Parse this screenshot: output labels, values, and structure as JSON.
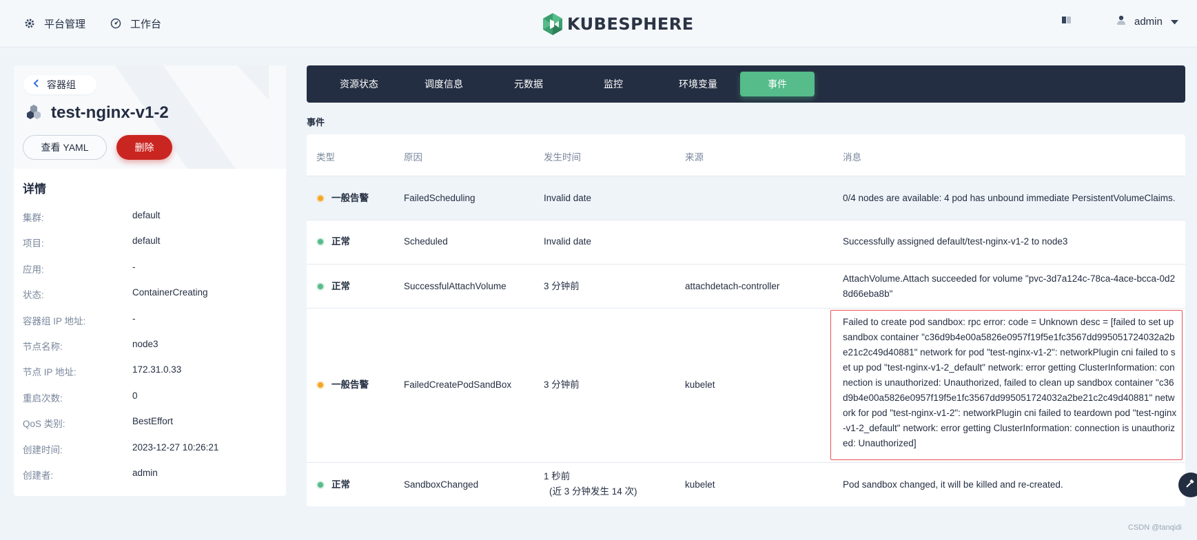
{
  "topbar": {
    "platform_label": "平台管理",
    "workbench_label": "工作台",
    "brand_text": "KUBESPHERE",
    "user_name": "admin",
    "icons": {
      "platform": "gear-icon",
      "workbench": "dashboard-icon",
      "docs": "book-icon",
      "user": "user-icon",
      "dropdown": "caret-down-icon"
    }
  },
  "sidebar": {
    "back_label": "容器组",
    "pod_name": "test-nginx-v1-2",
    "view_yaml_label": "查看 YAML",
    "delete_label": "删除",
    "details_title": "详情",
    "details": [
      {
        "key": "集群:",
        "value": "default"
      },
      {
        "key": "项目:",
        "value": "default"
      },
      {
        "key": "应用:",
        "value": "-"
      },
      {
        "key": "状态:",
        "value": "ContainerCreating"
      },
      {
        "key": "容器组 IP 地址:",
        "value": "-"
      },
      {
        "key": "节点名称:",
        "value": "node3"
      },
      {
        "key": "节点 IP 地址:",
        "value": "172.31.0.33"
      },
      {
        "key": "重启次数:",
        "value": "0"
      },
      {
        "key": "QoS 类别:",
        "value": "BestEffort"
      },
      {
        "key": "创建时间:",
        "value": "2023-12-27 10:26:21"
      },
      {
        "key": "创建者:",
        "value": "admin"
      }
    ]
  },
  "tabs": [
    {
      "label": "资源状态"
    },
    {
      "label": "调度信息"
    },
    {
      "label": "元数据"
    },
    {
      "label": "监控"
    },
    {
      "label": "环境变量"
    },
    {
      "label": "事件",
      "active": true
    }
  ],
  "events": {
    "section_title": "事件",
    "columns": [
      "类型",
      "原因",
      "发生时间",
      "来源",
      "消息"
    ],
    "rows": [
      {
        "type": "一般告警",
        "level": "warning",
        "reason": "FailedScheduling",
        "time": "Invalid date",
        "source": "",
        "message": "0/4 nodes are available: 4 pod has unbound immediate PersistentVolumeClaims."
      },
      {
        "type": "正常",
        "level": "normal",
        "reason": "Scheduled",
        "time": "Invalid date",
        "source": "",
        "message": "Successfully assigned default/test-nginx-v1-2 to node3"
      },
      {
        "type": "正常",
        "level": "normal",
        "reason": "SuccessfulAttachVolume",
        "time": "3 分钟前",
        "source": "attachdetach-controller",
        "message": "AttachVolume.Attach succeeded for volume \"pvc-3d7a124c-78ca-4ace-bcca-0d28d66eba8b\""
      },
      {
        "type": "一般告警",
        "level": "warning",
        "reason": "FailedCreatePodSandBox",
        "time": "3 分钟前",
        "source": "kubelet",
        "message": "Failed to create pod sandbox: rpc error: code = Unknown desc = [failed to set up sandbox container \"c36d9b4e00a5826e0957f19f5e1fc3567dd995051724032a2be21c2c49d40881\" network for pod \"test-nginx-v1-2\": networkPlugin cni failed to set up pod \"test-nginx-v1-2_default\" network: error getting ClusterInformation: connection is unauthorized: Unauthorized, failed to clean up sandbox container \"c36d9b4e00a5826e0957f19f5e1fc3567dd995051724032a2be21c2c49d40881\" network for pod \"test-nginx-v1-2\": networkPlugin cni failed to teardown pod \"test-nginx-v1-2_default\" network: error getting ClusterInformation: connection is unauthorized: Unauthorized]"
      },
      {
        "type": "正常",
        "level": "normal",
        "reason": "SandboxChanged",
        "time": "1 秒前",
        "time_sub": "(近 3 分钟发生 14 次)",
        "source": "kubelet",
        "message": "Pod sandbox changed, it will be killed and re-created."
      }
    ]
  },
  "footer": {
    "watermark": "CSDN @tanqidi"
  },
  "colors": {
    "accent_green": "#55bc8a",
    "danger": "#ca2621",
    "warning": "#f5a623",
    "dark": "#242e42",
    "highlight_border": "#e8515a"
  }
}
